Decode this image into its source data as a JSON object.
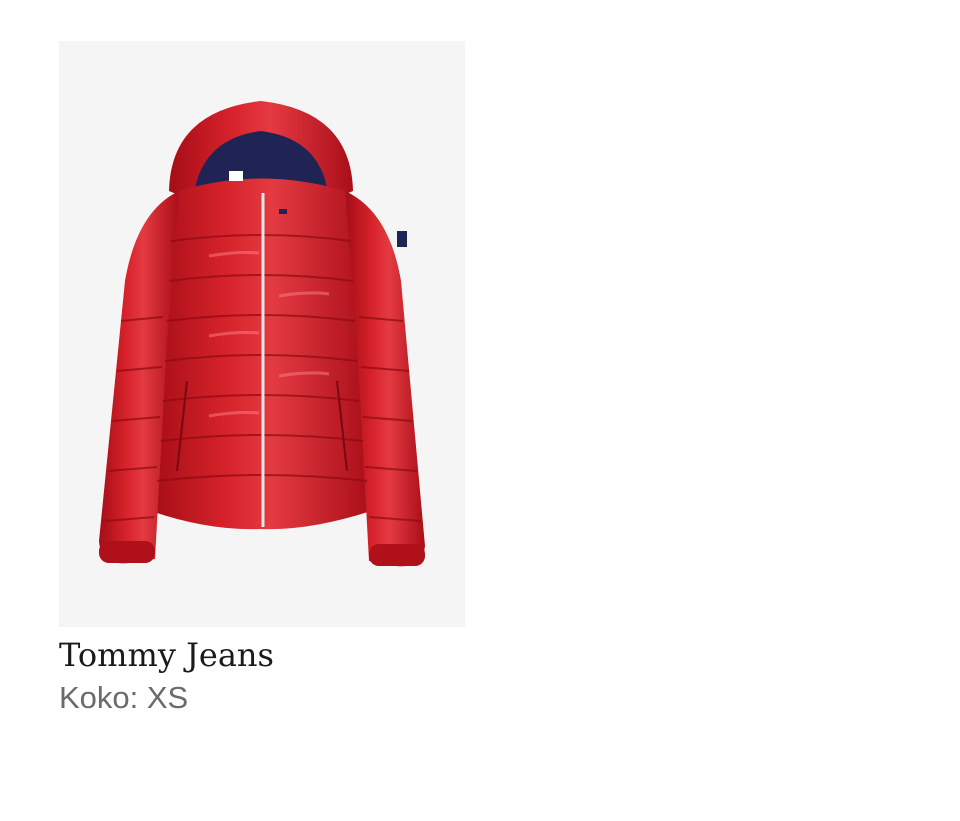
{
  "product": {
    "brand": "Tommy Jeans",
    "size_label": "Koko: XS",
    "image_icon": "red-puffer-jacket-image",
    "colors": {
      "image_background": "#f5f5f5",
      "jacket_red": "#c8141e",
      "lining_navy": "#1f2454",
      "brand_text": "#1a1a1a",
      "size_text": "#6b6b6b"
    }
  }
}
